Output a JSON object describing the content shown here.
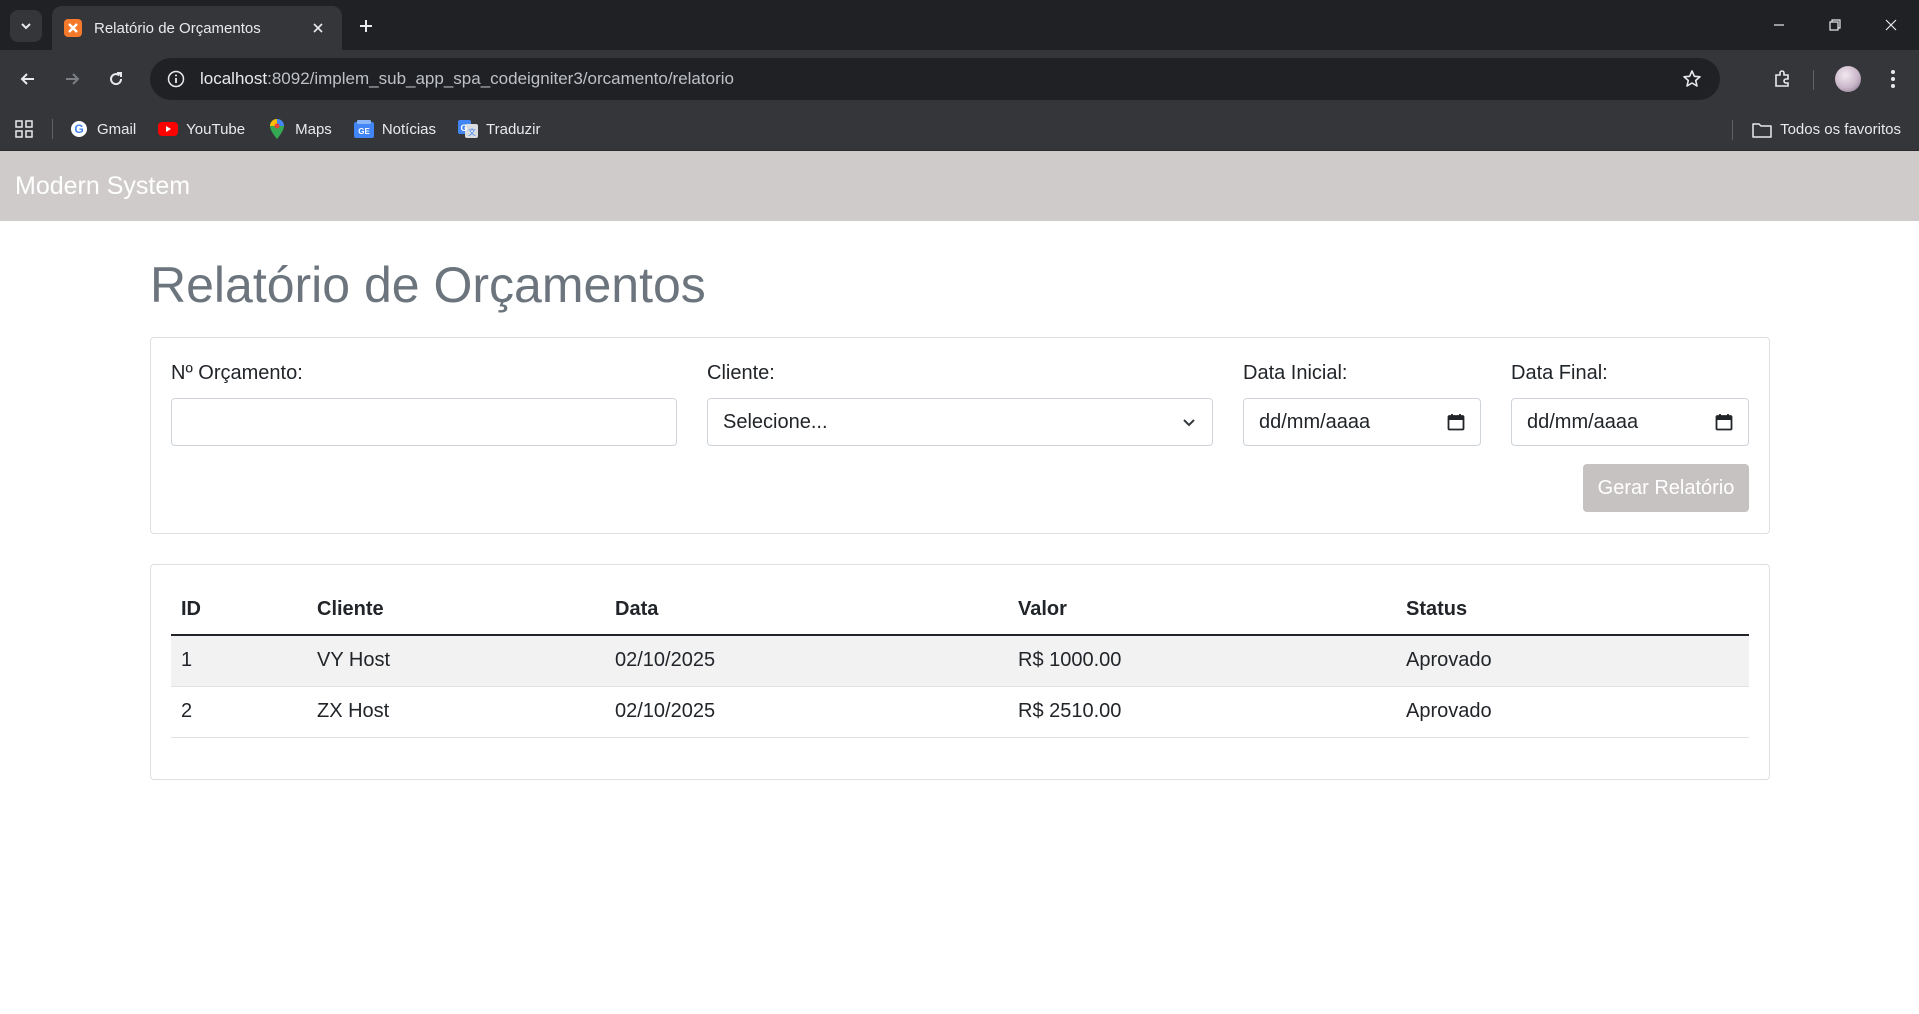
{
  "browser": {
    "tab_title": "Relatório de Orçamentos",
    "url_host": "localhost",
    "url_path": ":8092/implem_sub_app_spa_codeigniter3/orcamento/relatorio",
    "bookmarks": [
      {
        "label": "Gmail",
        "icon": "google-icon"
      },
      {
        "label": "YouTube",
        "icon": "youtube-icon"
      },
      {
        "label": "Maps",
        "icon": "maps-icon"
      },
      {
        "label": "Notícias",
        "icon": "news-icon"
      },
      {
        "label": "Traduzir",
        "icon": "translate-icon"
      }
    ],
    "all_bookmarks_label": "Todos os favoritos"
  },
  "app": {
    "brand": "Modern System",
    "navbar_color": "#cfcbcb"
  },
  "page": {
    "title": "Relatório de Orçamentos"
  },
  "filters": {
    "numero_label": "Nº Orçamento:",
    "numero_value": "",
    "cliente_label": "Cliente:",
    "cliente_selected": "Selecione...",
    "data_inicial_label": "Data Inicial:",
    "data_inicial_value": "dd/mm/aaaa",
    "data_final_label": "Data Final:",
    "data_final_value": "dd/mm/aaaa",
    "submit_label": "Gerar Relatório"
  },
  "table": {
    "headers": [
      "ID",
      "Cliente",
      "Data",
      "Valor",
      "Status"
    ],
    "rows": [
      [
        "1",
        "VY Host",
        "02/10/2025",
        "R$ 1000.00",
        "Aprovado"
      ],
      [
        "2",
        "ZX Host",
        "02/10/2025",
        "R$ 2510.00",
        "Aprovado"
      ]
    ]
  }
}
